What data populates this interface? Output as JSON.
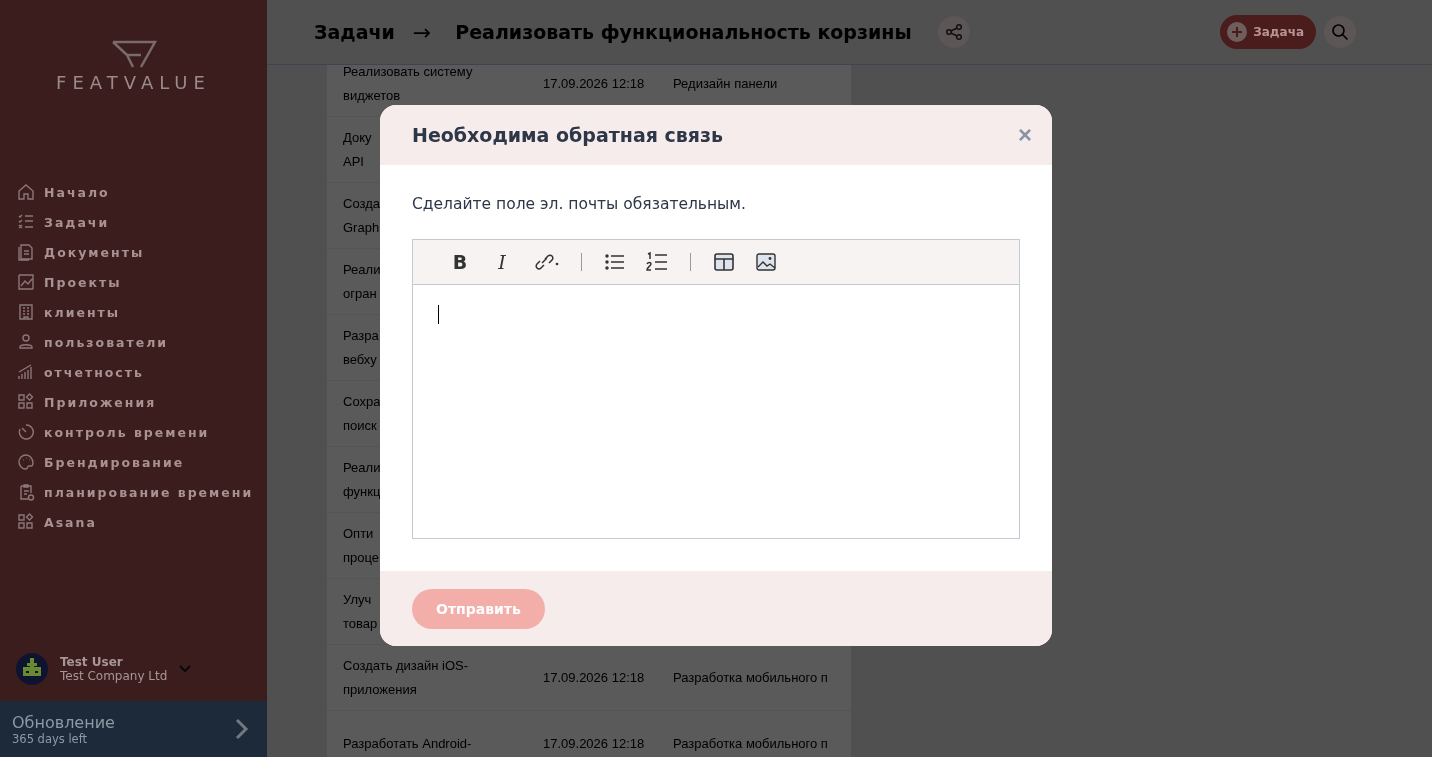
{
  "sidebar": {
    "logo": "FEATVALUE",
    "items": [
      {
        "label": "Начало"
      },
      {
        "label": "Задачи"
      },
      {
        "label": "Документы"
      },
      {
        "label": "Проекты"
      },
      {
        "label": "клиенты"
      },
      {
        "label": "пользователи"
      },
      {
        "label": "отчетность"
      },
      {
        "label": "Приложения"
      },
      {
        "label": "контроль времени"
      },
      {
        "label": "Брендирование"
      },
      {
        "label": "планирование времени"
      },
      {
        "label": "Asana"
      }
    ],
    "user": {
      "name": "Test User",
      "company": "Test Company Ltd"
    },
    "upgrade": {
      "title": "Обновление",
      "subtitle": "365 days left"
    }
  },
  "header": {
    "breadcrumb": "Задачи",
    "arrow": "→",
    "title": "Реализовать функциональность корзины",
    "new_button": "Задача"
  },
  "rows": [
    {
      "title": "Реализовать систему\nвиджетов",
      "date": "17.09.2026 12:18",
      "project": "Редизайн панели"
    },
    {
      "title": "Доку\nAPI"
    },
    {
      "title": "Созда\nGraph"
    },
    {
      "title": "Реали\nогран"
    },
    {
      "title": "Разра\nвебху"
    },
    {
      "title": "Сохра\nпоиск"
    },
    {
      "title": "Реали\nфункц"
    },
    {
      "title": "Опти\nпроце"
    },
    {
      "title": "Улуч\nтовар"
    },
    {
      "title": "Создать дизайн iOS-\nприложения",
      "date": "17.09.2026 12:18",
      "project": "Разработка мобильного п"
    },
    {
      "title": "Разработать Android-",
      "date": "17.09.2026 12:18",
      "project": "Разработка мобильного п"
    }
  ],
  "modal": {
    "title": "Необходима обратная связь",
    "close": "×",
    "message": "Сделайте поле эл. почты обязательным.",
    "toolbar": [
      {
        "kind": "bold",
        "label": "B"
      },
      {
        "kind": "italic",
        "label": "I"
      },
      {
        "kind": "link"
      },
      {
        "kind": "separator"
      },
      {
        "kind": "bullets"
      },
      {
        "kind": "numbers"
      },
      {
        "kind": "separator"
      },
      {
        "kind": "table"
      },
      {
        "kind": "image"
      }
    ],
    "submit": {
      "label": "Отправить",
      "disabled": true
    }
  }
}
